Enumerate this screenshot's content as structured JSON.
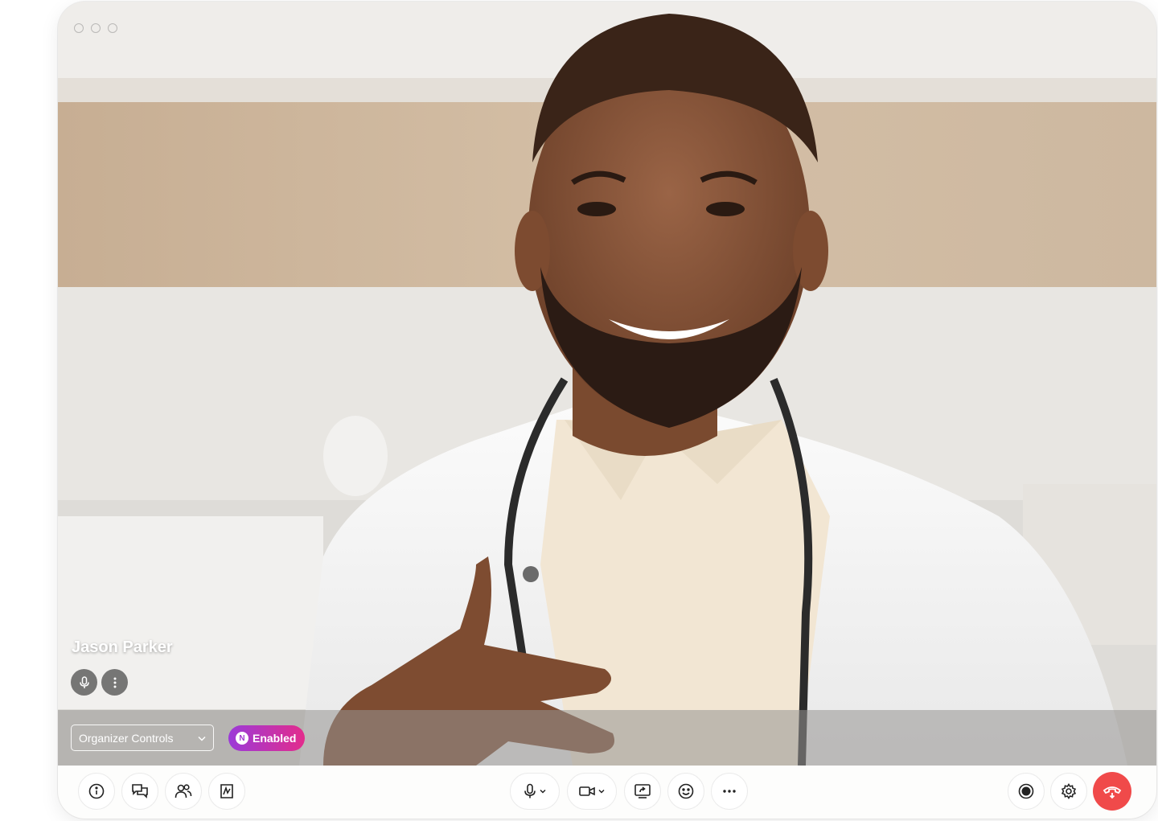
{
  "window": {
    "title_dots": [
      "close",
      "minimize",
      "maximize"
    ]
  },
  "video": {
    "participant": {
      "name": "Jason Parker",
      "controls": [
        {
          "icon": "microphone-icon"
        },
        {
          "icon": "more-vertical-icon"
        }
      ]
    }
  },
  "organizer_bar": {
    "select_label": "Organizer Controls",
    "badge_label": "Enabled",
    "badge_icon_letter": "N",
    "badge_gradient": [
      "#9b3ad8",
      "#e32c8c"
    ]
  },
  "toolbar": {
    "left": [
      {
        "icon": "info-icon"
      },
      {
        "icon": "chat-icon"
      },
      {
        "icon": "participants-icon"
      },
      {
        "icon": "whiteboard-icon"
      }
    ],
    "center": [
      {
        "icon": "microphone-icon",
        "has_dropdown": true
      },
      {
        "icon": "camera-icon",
        "has_dropdown": true
      },
      {
        "icon": "share-screen-icon"
      },
      {
        "icon": "emoji-icon"
      },
      {
        "icon": "more-horizontal-icon"
      }
    ],
    "right": [
      {
        "icon": "record-icon"
      },
      {
        "icon": "settings-icon"
      },
      {
        "icon": "end-call-icon",
        "color": "#f04a4a"
      }
    ]
  }
}
